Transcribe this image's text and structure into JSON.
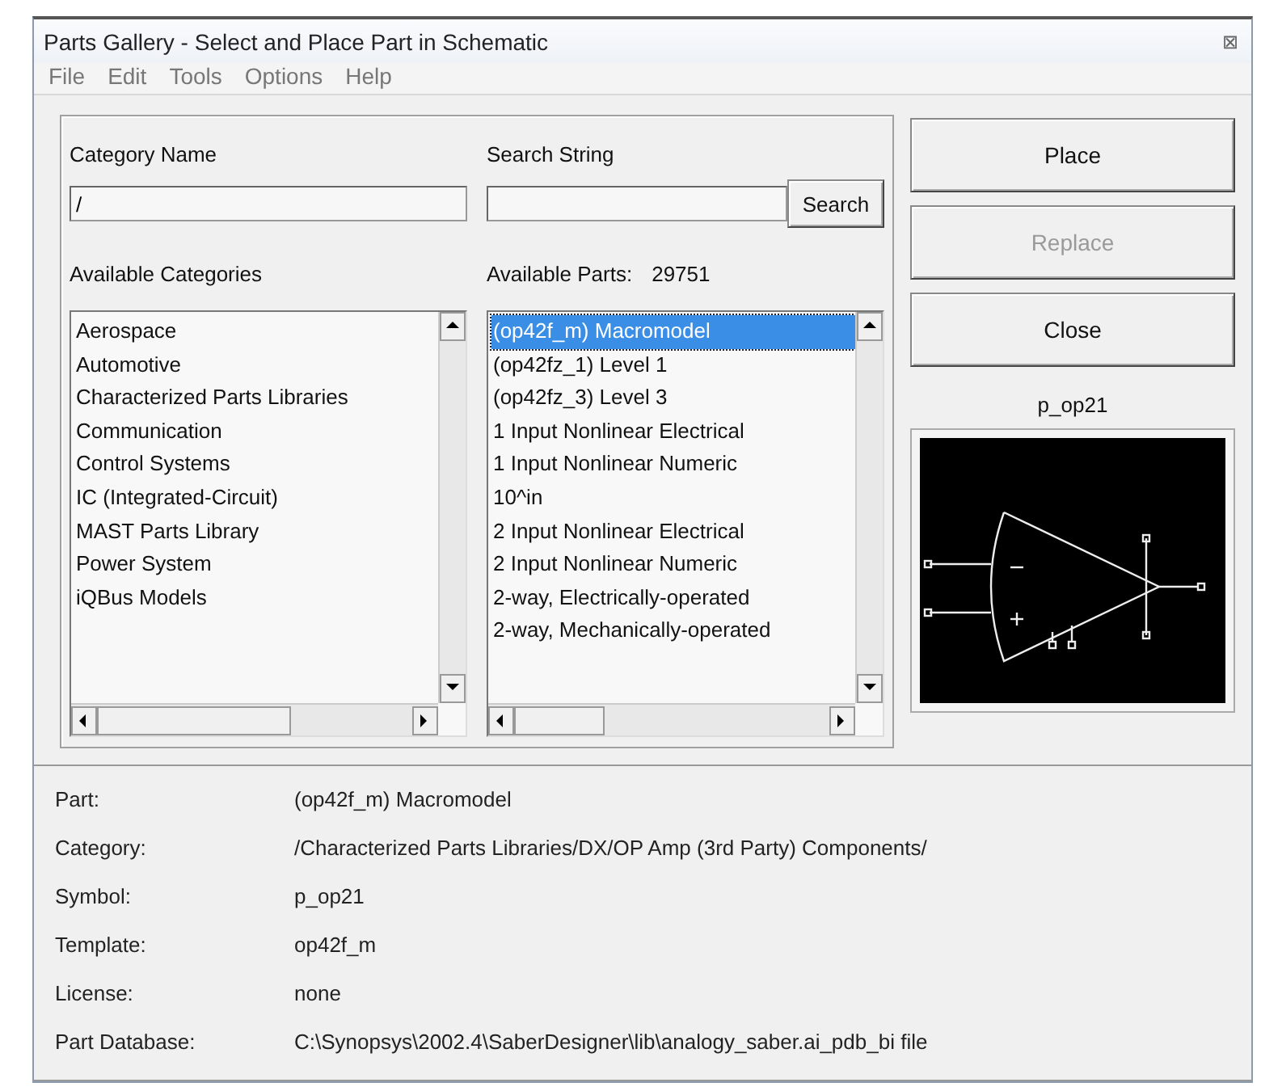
{
  "window": {
    "title": "Parts Gallery - Select and Place Part in Schematic",
    "close_glyph": "⊠"
  },
  "menu": [
    "File",
    "Edit",
    "Tools",
    "Options",
    "Help"
  ],
  "category_name": {
    "label": "Category Name",
    "value": "/"
  },
  "search_string": {
    "label": "Search String",
    "button": "Search"
  },
  "categories": {
    "label": "Available Categories",
    "items": [
      {
        "label": "Aerospace",
        "selected": false
      },
      {
        "label": "Automotive",
        "selected": false
      },
      {
        "label": "Characterized Parts Libraries",
        "selected": false
      },
      {
        "label": "Communication",
        "selected": false
      },
      {
        "label": "Control Systems",
        "selected": false
      },
      {
        "label": "IC (Integrated-Circuit)",
        "selected": false
      },
      {
        "label": "MAST Parts Library",
        "selected": false
      },
      {
        "label": "Power System",
        "selected": false
      },
      {
        "label": "iQBus Models",
        "selected": false
      }
    ]
  },
  "parts": {
    "label": "Available Parts:",
    "count": "29751",
    "items": [
      {
        "label": "(op42f_m) Macromodel",
        "selected": true
      },
      {
        "label": "(op42fz_1) Level 1",
        "selected": false
      },
      {
        "label": "(op42fz_3) Level 3",
        "selected": false
      },
      {
        "label": "1 Input Nonlinear Electrical",
        "selected": false
      },
      {
        "label": "1 Input Nonlinear Numeric",
        "selected": false
      },
      {
        "label": "10^in",
        "selected": false
      },
      {
        "label": "2 Input Nonlinear Electrical",
        "selected": false
      },
      {
        "label": "2 Input Nonlinear Numeric",
        "selected": false
      },
      {
        "label": "2-way, Electrically-operated",
        "selected": false
      },
      {
        "label": "2-way, Mechanically-operated",
        "selected": false
      }
    ]
  },
  "buttons": [
    {
      "label": "Place",
      "disabled": false
    },
    {
      "label": "Replace",
      "disabled": true
    },
    {
      "label": "Close",
      "disabled": false
    }
  ],
  "preview": {
    "symbol": "p_op21"
  },
  "details": [
    {
      "label": "Part:",
      "value": "(op42f_m) Macromodel"
    },
    {
      "label": "Category:",
      "value": "/Characterized Parts Libraries/DX/OP Amp (3rd Party)  Components/"
    },
    {
      "label": "Symbol:",
      "value": "p_op21"
    },
    {
      "label": "Template:",
      "value": "op42f_m"
    },
    {
      "label": "License:",
      "value": "none"
    },
    {
      "label": "Part Database:",
      "value": "C:\\Synopsys\\2002.4\\SaberDesigner\\lib\\analogy_saber.ai_pdb_bi file"
    }
  ]
}
